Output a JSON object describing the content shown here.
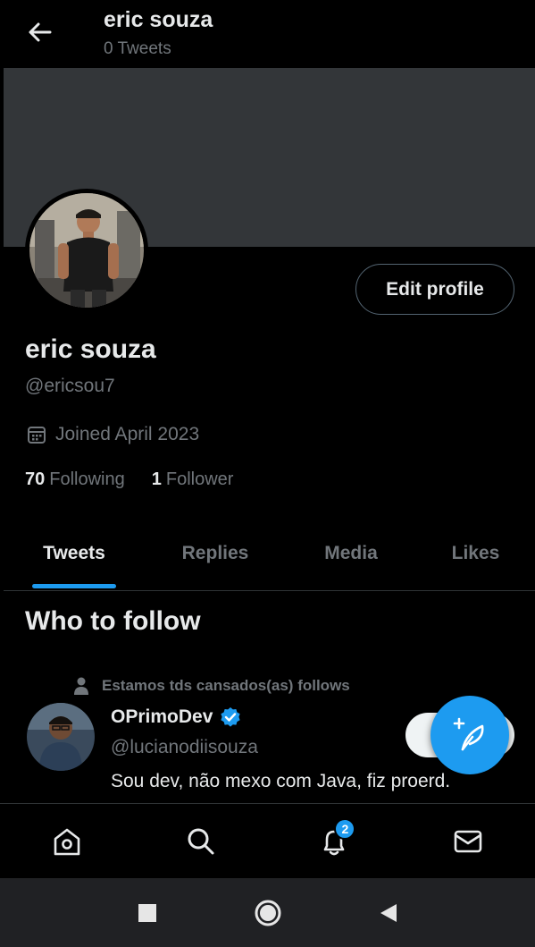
{
  "header": {
    "title": "eric souza",
    "subtitle": "0 Tweets"
  },
  "profile": {
    "name": "eric souza",
    "handle": "@ericsou7",
    "joined": "Joined April 2023",
    "following_count": "70",
    "following_label": "Following",
    "followers_count": "1",
    "followers_label": "Follower",
    "edit_button": "Edit profile"
  },
  "tabs": [
    {
      "label": "Tweets",
      "active": true
    },
    {
      "label": "Replies",
      "active": false
    },
    {
      "label": "Media",
      "active": false
    },
    {
      "label": "Likes",
      "active": false
    }
  ],
  "who_to_follow": {
    "title": "Who to follow",
    "suggestion": {
      "context": "Estamos tds cansados(as) follows",
      "name": "OPrimoDev",
      "handle": "@lucianodiisouza",
      "bio": "Sou dev, não mexo com Java, fiz proerd.",
      "verified": true
    }
  },
  "bottom_nav": {
    "items": [
      "home-icon",
      "search-icon",
      "notifications-icon",
      "messages-icon"
    ],
    "notification_badge": "2"
  },
  "system_nav": [
    "recents-square-icon",
    "home-circle-icon",
    "back-triangle-icon"
  ],
  "colors": {
    "accent": "#1d9bf0",
    "background": "#000000",
    "banner": "#333639",
    "muted": "#71767b"
  }
}
